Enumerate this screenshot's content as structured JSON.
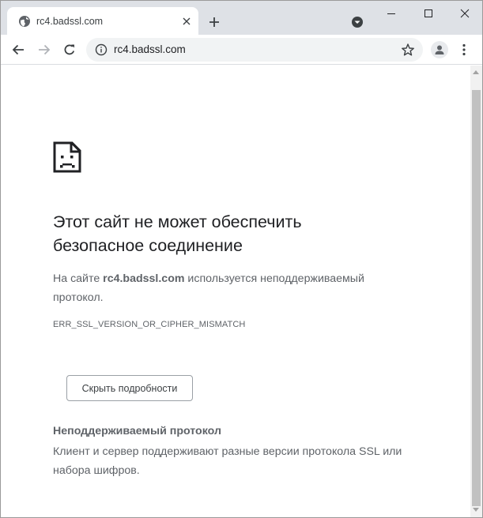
{
  "tab": {
    "title": "rc4.badssl.com",
    "favicon": "globe-icon"
  },
  "toolbar": {
    "url": "rc4.badssl.com",
    "back_icon": "back-arrow-icon",
    "forward_icon": "forward-arrow-icon",
    "reload_icon": "reload-icon"
  },
  "error": {
    "heading": "Этот сайт не может обеспечить безопасное соединение",
    "desc_prefix": "На сайте ",
    "desc_host": "rc4.badssl.com",
    "desc_suffix": " используется неподдерживаемый протокол.",
    "code": "ERR_SSL_VERSION_OR_CIPHER_MISMATCH",
    "details_button": "Скрыть подробности",
    "details_title": "Неподдерживаемый протокол",
    "details_text": "Клиент и сервер поддерживают разные версии протокола SSL или набора шифров."
  },
  "colors": {
    "tabstrip": "#dee1e6",
    "text_primary": "#202124",
    "text_secondary": "#5f6368"
  }
}
